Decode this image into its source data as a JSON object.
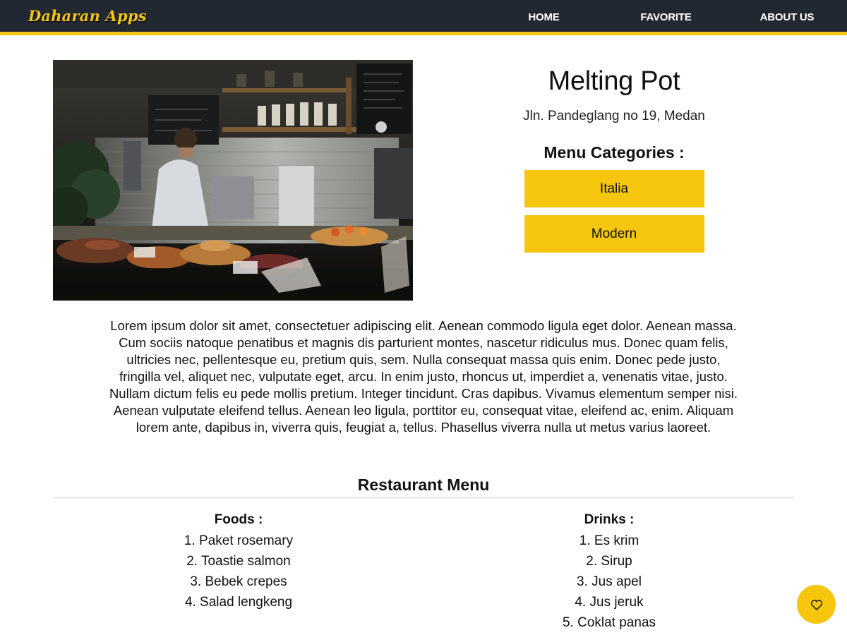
{
  "nav": {
    "brand": "Daharan Apps",
    "links": [
      {
        "label": "HOME"
      },
      {
        "label": "FAVORITE"
      },
      {
        "label": "ABOUT US"
      }
    ]
  },
  "restaurant": {
    "name": "Melting Pot",
    "address": "Jln. Pandeglang no 19, Medan",
    "categories_heading": "Menu Categories :",
    "categories": [
      "Italia",
      "Modern"
    ],
    "description": "Lorem ipsum dolor sit amet, consectetuer adipiscing elit. Aenean commodo ligula eget dolor. Aenean massa. Cum sociis natoque penatibus et magnis dis parturient montes, nascetur ridiculus mus. Donec quam felis, ultricies nec, pellentesque eu, pretium quis, sem. Nulla consequat massa quis enim. Donec pede justo, fringilla vel, aliquet nec, vulputate eget, arcu. In enim justo, rhoncus ut, imperdiet a, venenatis vitae, justo. Nullam dictum felis eu pede mollis pretium. Integer tincidunt. Cras dapibus. Vivamus elementum semper nisi. Aenean vulputate eleifend tellus. Aenean leo ligula, porttitor eu, consequat vitae, eleifend ac, enim. Aliquam lorem ante, dapibus in, viverra quis, feugiat a, tellus. Phasellus viverra nulla ut metus varius laoreet."
  },
  "menu": {
    "title": "Restaurant Menu",
    "foods": {
      "heading": "Foods :",
      "items": [
        "1. Paket rosemary",
        "2. Toastie salmon",
        "3. Bebek crepes",
        "4. Salad lengkeng"
      ]
    },
    "drinks": {
      "heading": "Drinks :",
      "items": [
        "1. Es krim",
        "2. Sirup",
        "3. Jus apel",
        "4. Jus jeruk",
        "5. Coklat panas"
      ]
    }
  },
  "fab": {
    "icon": "heart-outline-icon"
  },
  "colors": {
    "navbar_bg": "#222831",
    "accent": "#f5c518",
    "category_bg": "#f5c60d"
  }
}
